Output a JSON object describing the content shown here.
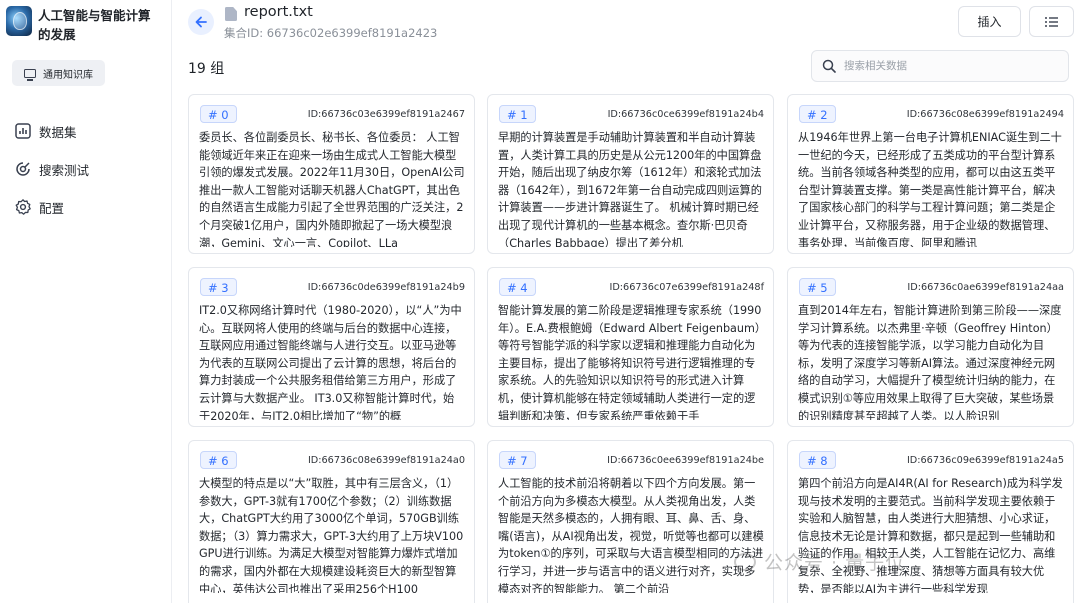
{
  "brand": {
    "title": "人工智能与智能计算的发展"
  },
  "sidebar": {
    "kb_tag": "通用知识库",
    "items": [
      {
        "label": "数据集",
        "icon": "bar-chart-icon"
      },
      {
        "label": "搜索测试",
        "icon": "search-test-icon"
      },
      {
        "label": "配置",
        "icon": "gear-icon"
      }
    ]
  },
  "header": {
    "file_name": "report.txt",
    "collection_id": "集合ID: 66736c02e6399ef8191a2423",
    "insert_label": "插入"
  },
  "toolbar": {
    "group_count": "19 组",
    "search_placeholder": "搜索相关数据"
  },
  "cards": [
    {
      "index": "# 0",
      "id": "ID:66736c03e6399ef8191a2467",
      "text": "委员长、各位副委员长、秘书长、各位委员： 人工智能领域近年来正在迎来一场由生成式人工智能大模型引领的爆发式发展。2022年11月30日，OpenAI公司推出一款人工智能对话聊天机器人ChatGPT，其出色的自然语言生成能力引起了全世界范围的广泛关注，2个月突破1亿用户，国内外随即掀起了一场大模型浪潮，Gemini、文心一言、Copilot、LLa"
    },
    {
      "index": "# 1",
      "id": "ID:66736c0ce6399ef8191a24b4",
      "text": "早期的计算装置是手动辅助计算装置和半自动计算装置，人类计算工具的历史是从公元1200年的中国算盘开始，随后出现了纳皮尔筹（1612年）和滚轮式加法器（1642年），到1672年第一台自动完成四则运算的计算装置——步进计算器诞生了。 机械计算时期已经出现了现代计算机的一些基本概念。查尔斯·巴贝奇（Charles Babbage）提出了差分机"
    },
    {
      "index": "# 2",
      "id": "ID:66736c08e6399ef8191a2494",
      "text": "从1946年世界上第一台电子计算机ENIAC诞生到二十一世纪的今天，已经形成了五类成功的平台型计算系统。当前各领域各种类型的应用，都可以由这五类平台型计算装置支撑。第一类是高性能计算平台，解决了国家核心部门的科学与工程计算问题；第二类是企业计算平台，又称服务器，用于企业级的数据管理、事务处理，当前像百度、阿里和腾讯"
    },
    {
      "index": "# 3",
      "id": "ID:66736c0de6399ef8191a24b9",
      "text": "IT2.0又称网络计算时代（1980-2020），以“人”为中心。互联网将人使用的终端与后台的数据中心连接，互联网应用通过智能终端与人进行交互。以亚马逊等为代表的互联网公司提出了云计算的思想，将后台的算力封装成一个公共服务租借给第三方用户，形成了云计算与大数据产业。 IT3.0又称智能计算时代，始于2020年，与IT2.0相比增加了“物”的概"
    },
    {
      "index": "# 4",
      "id": "ID:66736c07e6399ef8191a248f",
      "text": "智能计算发展的第二阶段是逻辑推理专家系统（1990年）。E.A.费根鲍姆（Edward Albert Feigenbaum）等符号智能学派的科学家以逻辑和推理能力自动化为主要目标，提出了能够将知识符号进行逻辑推理的专家系统。人的先验知识以知识符号的形式进入计算机，使计算机能够在特定领域辅助人类进行一定的逻辑判断和决策，但专家系统严重依赖于手"
    },
    {
      "index": "# 5",
      "id": "ID:66736c0ae6399ef8191a24aa",
      "text": "直到2014年左右，智能计算进阶到第三阶段——深度学习计算系统。以杰弗里·辛顿（Geoffrey Hinton）等为代表的连接智能学派，以学习能力自动化为目标，发明了深度学习等新AI算法。通过深度神经元网络的自动学习，大幅提升了模型统计归纳的能力，在模式识别①等应用效果上取得了巨大突破，某些场景的识别精度甚至超越了人类。以人脸识别"
    },
    {
      "index": "# 6",
      "id": "ID:66736c08e6399ef8191a24a0",
      "text": "大模型的特点是以“大”取胜，其中有三层含义，（1）参数大，GPT-3就有1700亿个参数；（2）训练数据大，ChatGPT大约用了3000亿个单词，570GB训练数据；（3）算力需求大，GPT-3大约用了上万块V100 GPU进行训练。为满足大模型对智能算力爆炸式增加的需求，国内外都在大规模建设耗资巨大的新型智算中心，英伟达公司也推出了采用256个H100"
    },
    {
      "index": "# 7",
      "id": "ID:66736c0ee6399ef8191a24be",
      "text": "人工智能的技术前沿将朝着以下四个方向发展。第一个前沿方向为多模态大模型。从人类视角出发，人类智能是天然多模态的，人拥有眼、耳、鼻、舌、身、嘴(语言)，从AI视角出发，视觉，听觉等也都可以建模为token①的序列，可采取与大语言模型相同的方法进行学习，并进一步与语言中的语义进行对齐，实现多模态对齐的智能能力。 第二个前沿"
    },
    {
      "index": "# 8",
      "id": "ID:66736c09e6399ef8191a24a5",
      "text": "第四个前沿方向是AI4R(AI for Research)成为科学发现与技术发明的主要范式。当前科学发现主要依赖于实验和人脑智慧，由人类进行大胆猜想、小心求证，信息技术无论是计算和数据，都只是起到一些辅助和验证的作用。相较于人类，人工智能在记忆力、高维复杂、全视野、推理深度、猜想等方面具有较大优势，是否能以AI为主进行一些科学发现"
    }
  ],
  "watermark": "公众号 · 量子位"
}
